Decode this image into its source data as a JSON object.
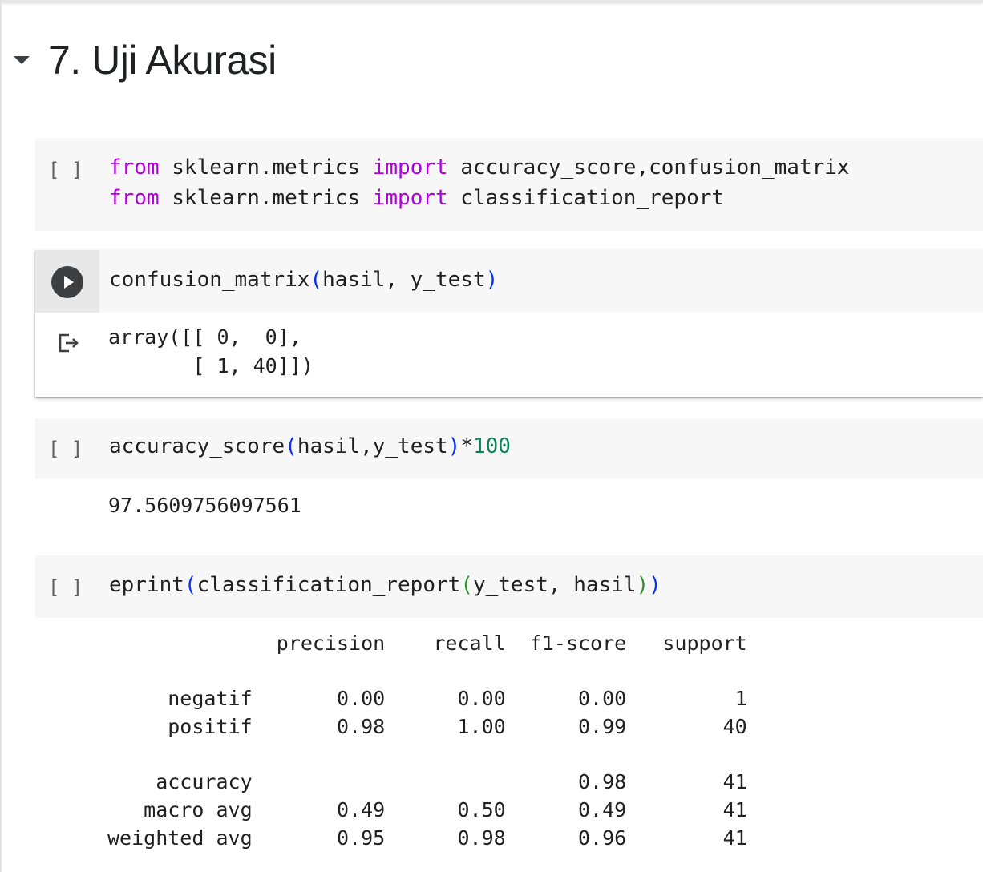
{
  "section": {
    "title": "7. Uji Akurasi"
  },
  "cells": {
    "import_cell": {
      "run_label": "[ ]",
      "line1": {
        "kw1": "from",
        "mid1": " sklearn.metrics ",
        "kw2": "import",
        "rest": " accuracy_score,confusion_matrix"
      },
      "line2": {
        "kw1": "from",
        "mid1": " sklearn.metrics ",
        "kw2": "import",
        "rest": " classification_report"
      }
    },
    "confusion_cell": {
      "code": {
        "fn": "confusion_matrix",
        "open": "(",
        "args": "hasil, y_test",
        "close": ")"
      },
      "output": {
        "line1": "array([[ 0,  0],",
        "line2": "       [ 1, 40]])"
      }
    },
    "accuracy_cell": {
      "run_label": "[ ]",
      "code": {
        "fn": "accuracy_score",
        "open": "(",
        "args": "hasil,y_test",
        "close": ")",
        "op": "*",
        "num": "100"
      },
      "output": "97.5609756097561"
    },
    "report_cell": {
      "run_label": "[ ]",
      "code": {
        "fn": "eprint",
        "open1": "(",
        "inner": "classification_report",
        "open2": "(",
        "args": "y_test, hasil",
        "close2": ")",
        "close1": ")"
      },
      "output": {
        "header": "              precision    recall  f1-score   support",
        "row_negatif": "     negatif       0.00      0.00      0.00         1",
        "row_positif": "     positif       0.98      1.00      0.99        40",
        "row_accuracy": "    accuracy                           0.98        41",
        "row_macro": "   macro avg       0.49      0.50      0.49        41",
        "row_weighted": "weighted avg       0.95      0.98      0.96        41"
      }
    }
  },
  "icons": {
    "collapse": "caret-down-icon",
    "run": "play-icon",
    "output": "output-redirect-icon"
  },
  "colors": {
    "keyword": "#af00db",
    "paren": "#0431fa",
    "number": "#098658",
    "paren_inner": "#319331"
  }
}
